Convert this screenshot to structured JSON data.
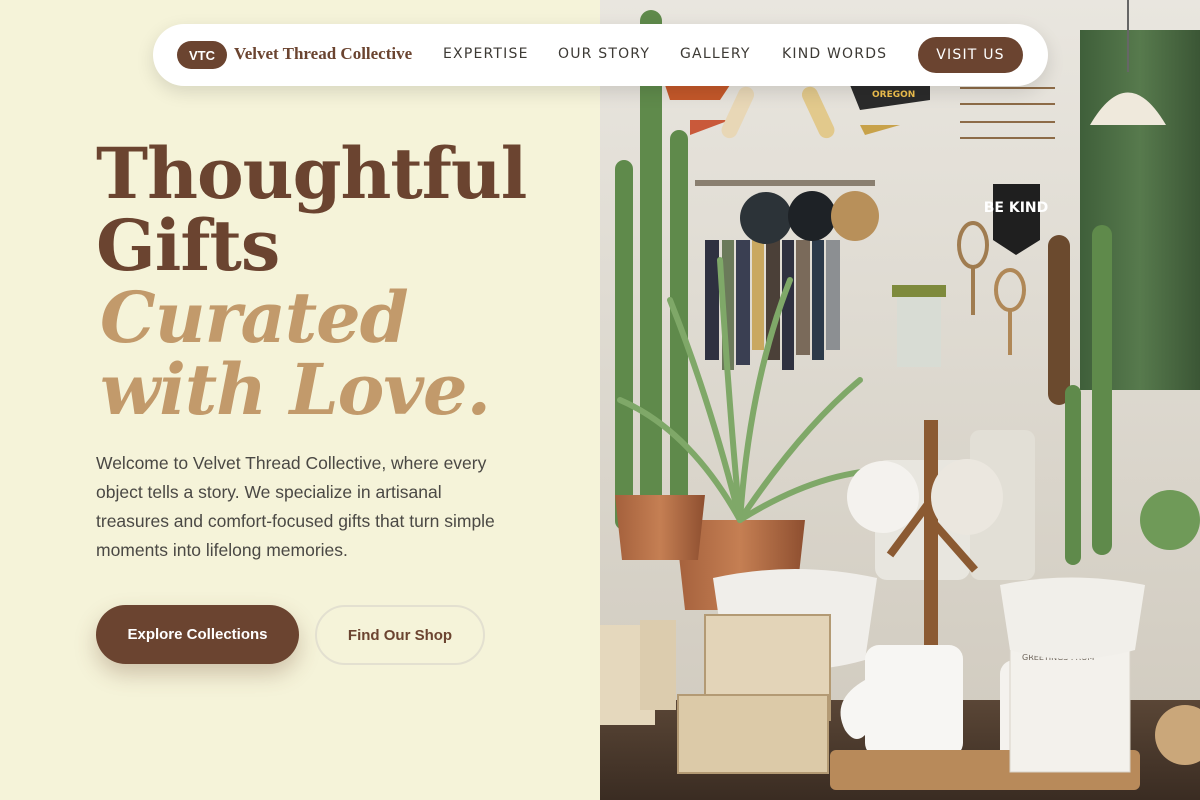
{
  "nav": {
    "logo_badge": "VTC",
    "logo_text": "Velvet Thread Collective",
    "links": [
      {
        "label": "EXPERTISE"
      },
      {
        "label": "OUR STORY"
      },
      {
        "label": "GALLERY"
      },
      {
        "label": "KIND WORDS"
      }
    ],
    "cta_label": "VISIT US"
  },
  "hero": {
    "headline_line1": "Thoughtful",
    "headline_line2": "Gifts",
    "accent_line1": "Curated",
    "accent_line2": "with Love.",
    "intro": "Welcome to Velvet Thread Collective, where every object tells a story. We specialize in artisanal treasures and comfort-focused gifts that turn simple moments into lifelong memories.",
    "primary_button": "Explore Collections",
    "secondary_button": "Find Our Shop"
  },
  "photo": {
    "pennant_text": "OREGON",
    "banner_text": "BE KIND",
    "card_text": "GREETINGS FROM"
  },
  "colors": {
    "background": "#f5f3d9",
    "brand_brown": "#6b4430",
    "accent_tan": "#c29a6b",
    "body_text": "#4a4844"
  }
}
